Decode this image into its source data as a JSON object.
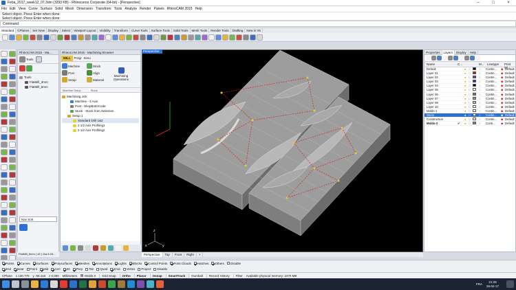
{
  "window": {
    "title": "Feba_2017_week12_07.3dm (3293 KB) - Rhinoceros Corporate (64-bit) - [Perspective]"
  },
  "menu": [
    "File",
    "Edit",
    "View",
    "Curve",
    "Surface",
    "Solid",
    "Mesh",
    "Dimension",
    "Transform",
    "Tools",
    "Analyze",
    "Render",
    "Panels",
    "RhinoCAM 2015",
    "Help"
  ],
  "command_history": [
    "Select object. Press Enter when done:",
    "Select object. Press Enter when done:",
    "Select object. Press Enter when done:"
  ],
  "command_prompt": "Command:",
  "toolbar_tabs": [
    "Standard",
    "CPlanes",
    "Set View",
    "Display",
    "Select",
    "Viewport Layout",
    "Visibility",
    "Transform",
    "Curve Tools",
    "Surface Tools",
    "Solid Tools",
    "Mesh Tools",
    "Render Tools",
    "Drafting",
    "New in V5"
  ],
  "tools_panel": {
    "title": "RhinoCAM 2015 - Ma...",
    "tools_label": "Tools",
    "tree_root": "Tools",
    "tree_items": [
      "FlatMill_3mm",
      "FlatMill_6mm"
    ],
    "nav_label": "Nav Sort",
    "footer": "FlatMill_6mm ( #2 ) Dia:5.25..."
  },
  "machining_browser": {
    "title": "RhinoCAM 2015 - Machining Browser",
    "mill_tab": "MILL",
    "tab2": "Progr",
    "tab3": "Simu",
    "machine_label": "Machine",
    "post_label": "Post",
    "setup_label": "Setup",
    "stock_label": "Stock",
    "align_label": "Align",
    "material_label": "Material",
    "operations_label": "Machining Operations",
    "group1": "Machine Setup",
    "group2": "Stock",
    "tree": [
      "Machining Job",
      "Machine - 3 Axis",
      "Post - ShopBotGCode",
      "Stock - Stock from Selection",
      "Setup 1",
      "Standard Drill 1&2",
      "2 1/2 Axis Profiling1",
      "2 1/2 Axis Profiling2"
    ]
  },
  "viewport": {
    "label": "Perspective",
    "axis_z": "z",
    "axis_x": "x",
    "axis_y": "y",
    "tabs": [
      "Perspective",
      "Top",
      "Front",
      "Right",
      "+"
    ]
  },
  "layers_panel": {
    "tabs": [
      "Properties",
      "Layers",
      "Display",
      "Help"
    ],
    "columns": {
      "name": "Name",
      "current": "C...",
      "material": "M...",
      "linetype": "Linetype",
      "print_width": "Print Wi..."
    },
    "layers": [
      {
        "name": "Default",
        "color": "#000000",
        "linetype": "Contin...",
        "print": "Default",
        "current": false,
        "selected": false,
        "bold": false
      },
      {
        "name": "Layer 01",
        "color": "#cc1111",
        "linetype": "Contin...",
        "print": "Default",
        "current": false,
        "selected": false,
        "bold": false
      },
      {
        "name": "Layer 02",
        "color": "#6a3fb8",
        "linetype": "Contin...",
        "print": "Default",
        "current": false,
        "selected": false,
        "bold": false
      },
      {
        "name": "Layer 03",
        "color": "#1133cc",
        "linetype": "Contin...",
        "print": "Default",
        "current": false,
        "selected": false,
        "bold": false
      },
      {
        "name": "Layer 04",
        "color": "#111111",
        "linetype": "Contin...",
        "print": "Default",
        "current": false,
        "selected": false,
        "bold": false
      },
      {
        "name": "Layer 05",
        "color": "#ffffff",
        "linetype": "Contin...",
        "print": "Default",
        "current": false,
        "selected": false,
        "bold": false
      },
      {
        "name": "Layer 06",
        "color": "#777777",
        "linetype": "Contin...",
        "print": "Default",
        "current": false,
        "selected": false,
        "bold": false
      },
      {
        "name": "Layer 07",
        "color": "#999999",
        "linetype": "Contin...",
        "print": "Default",
        "current": false,
        "selected": false,
        "bold": false
      },
      {
        "name": "Layer 08",
        "color": "#bbbbbb",
        "linetype": "Contin...",
        "print": "Default",
        "current": false,
        "selected": false,
        "bold": false
      },
      {
        "name": "Layer 10",
        "color": "#ffffff",
        "linetype": "Contin...",
        "print": "Default",
        "current": false,
        "selected": false,
        "bold": false
      },
      {
        "name": "Molds-1",
        "color": "#ffffff",
        "linetype": "Contin...",
        "print": "Default",
        "current": false,
        "selected": false,
        "bold": false
      },
      {
        "name": "Stock",
        "color": "#ffffff",
        "linetype": "Contin...",
        "print": "Default",
        "current": false,
        "selected": true,
        "bold": false
      },
      {
        "name": "Construction",
        "color": "#ffffff",
        "linetype": "Contin...",
        "print": "Default",
        "current": false,
        "selected": false,
        "bold": false
      },
      {
        "name": "Molds-2",
        "color": "#888888",
        "linetype": "Conti...",
        "print": "Default",
        "current": true,
        "selected": false,
        "bold": true
      }
    ]
  },
  "osnap": {
    "filters": [
      {
        "label": "Points",
        "on": true
      },
      {
        "label": "Curves",
        "on": true
      },
      {
        "label": "Surfaces",
        "on": true
      },
      {
        "label": "Polysurfaces",
        "on": true
      },
      {
        "label": "Meshes",
        "on": true
      },
      {
        "label": "Annotations",
        "on": true
      },
      {
        "label": "Lights",
        "on": true
      },
      {
        "label": "Blocks",
        "on": true
      },
      {
        "label": "Control Points",
        "on": true
      },
      {
        "label": "Point Clouds",
        "on": true
      },
      {
        "label": "Hatches",
        "on": true
      },
      {
        "label": "Others",
        "on": true
      },
      {
        "label": "Disable",
        "on": false
      }
    ],
    "snaps": [
      {
        "label": "End",
        "on": true
      },
      {
        "label": "Near",
        "on": true
      },
      {
        "label": "Point",
        "on": false
      },
      {
        "label": "Mid",
        "on": true
      },
      {
        "label": "Cen",
        "on": true
      },
      {
        "label": "Int",
        "on": true
      },
      {
        "label": "Perp",
        "on": true
      },
      {
        "label": "Tan",
        "on": false
      },
      {
        "label": "Quad",
        "on": false
      },
      {
        "label": "Knot",
        "on": true
      },
      {
        "label": "Vertex",
        "on": false
      },
      {
        "label": "Project",
        "on": false
      },
      {
        "label": "Disable",
        "on": false
      }
    ]
  },
  "status": {
    "cplane": "CPlane",
    "x": "x 130.770",
    "y": "y -59.118",
    "z": "z 0.000",
    "units": "Millimeters",
    "layer": "Molds-2",
    "panes": [
      "Grid Snap",
      "Ortho",
      "Planar",
      "Osnap",
      "SmartTrack",
      "Gumball",
      "Record History",
      "Filter"
    ],
    "memory": "Available physical memory: 2470 MB"
  },
  "taskbar": {
    "time": "21:29",
    "date": "26-04-17",
    "lang": "FRA"
  },
  "colors": {
    "selection": "#2d6fd3",
    "viewport_bg": "#000000",
    "model_gray": "#9a9a9a",
    "toolpath_red": "#e02020",
    "marker_yellow": "#e8d02a"
  }
}
